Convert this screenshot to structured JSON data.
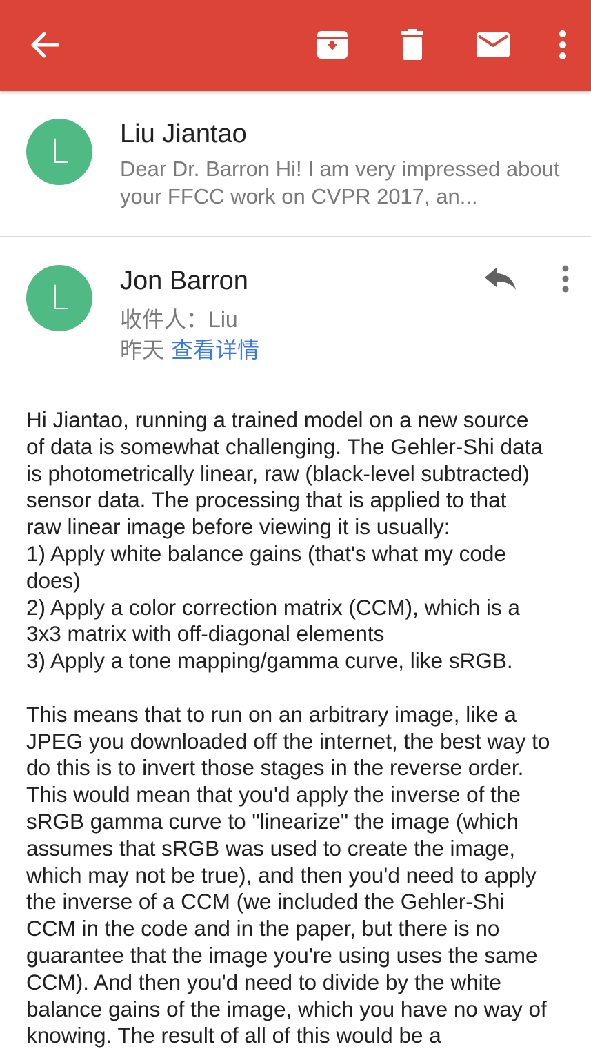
{
  "toolbar": {
    "back_icon": "arrow-back-icon",
    "archive_icon": "archive-icon",
    "delete_icon": "delete-icon",
    "mark_unread_icon": "mail-icon",
    "more_icon": "more-vert-icon",
    "color": "#db4437"
  },
  "thread": {
    "collapsed_message": {
      "avatar_letter": "L",
      "avatar_color": "#4fba84",
      "sender": "Liu Jiantao",
      "snippet": "Dear Dr. Barron Hi! I am very impressed about your FFCC work on CVPR 2017, an..."
    },
    "expanded_message": {
      "avatar_letter": "L",
      "sender": "Jon Barron",
      "recipient_prefix": "收件人：",
      "recipient": "Liu",
      "date": "昨天",
      "details_link": "查看详情",
      "reply_icon": "reply-icon",
      "more_icon": "more-vert-icon",
      "body_lines": [
        "Hi Jiantao, running a trained model on a new source",
        "of data is somewhat challenging. The Gehler-Shi data",
        "is photometrically linear, raw (black-level subtracted)",
        "sensor data. The processing that is applied to that",
        "raw linear image before viewing it is usually:",
        "1) Apply white balance gains (that's what my code",
        "does)",
        "2) Apply a color correction matrix (CCM), which is a",
        "3x3 matrix with off-diagonal elements",
        "3) Apply a tone mapping/gamma curve, like sRGB.",
        "",
        "This means that to run on an arbitrary image, like a",
        "JPEG you downloaded off the internet, the best way to",
        "do this is to invert those stages in the reverse order.",
        "This would mean that you'd apply the inverse of the",
        "sRGB gamma curve to \"linearize\" the image (which",
        "assumes that sRGB was used to create the image,",
        "which may not be true), and then you'd need to apply",
        "the inverse of a CCM (we included the Gehler-Shi",
        "CCM in the code and in the paper, but there is no",
        "guarantee that the image you're using uses the same",
        "CCM). And then you'd need to divide by the white",
        "balance gains of the image, which you have no way of",
        "knowing. The result of all of this would be a"
      ]
    }
  }
}
